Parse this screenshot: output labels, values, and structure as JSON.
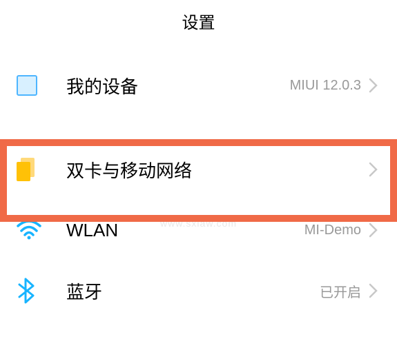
{
  "header": {
    "title": "设置"
  },
  "rows": {
    "device": {
      "label": "我的设备",
      "value": "MIUI 12.0.3"
    },
    "sim": {
      "label": "双卡与移动网络",
      "value": ""
    },
    "wlan": {
      "label": "WLAN",
      "value": "MI-Demo"
    },
    "bt": {
      "label": "蓝牙",
      "value": "已开启"
    }
  },
  "watermark": "www.sxlaw.com",
  "colors": {
    "highlight": "#f06a47",
    "wifi": "#18b4ff",
    "bluetooth": "#18b4ff",
    "sim": "#ffc107",
    "device_border": "#4db5ff"
  }
}
